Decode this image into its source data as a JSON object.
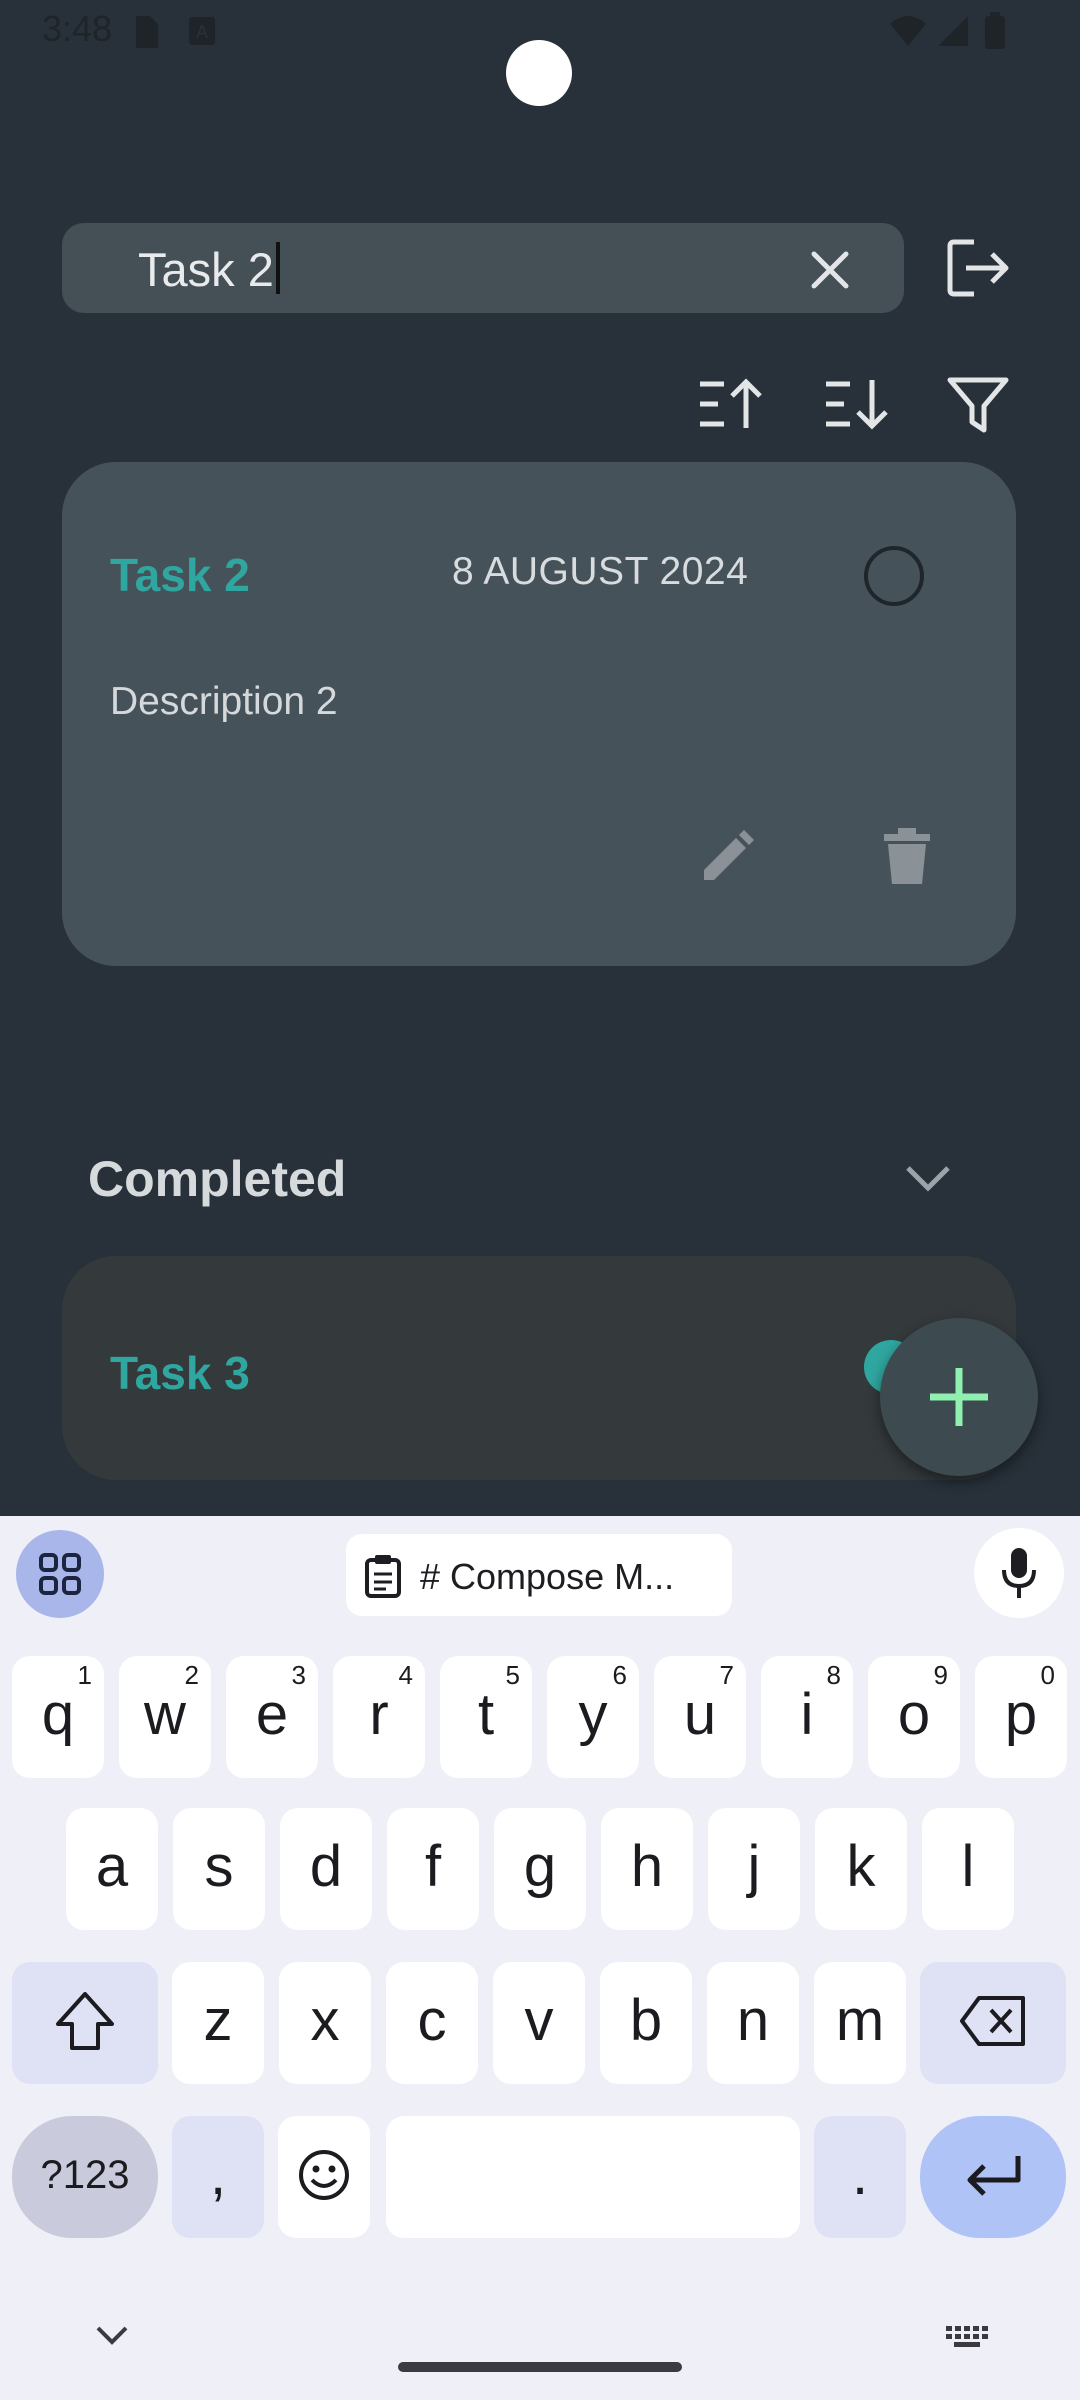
{
  "status_bar": {
    "time": "3:48"
  },
  "search": {
    "value": "Task 2"
  },
  "tasks": [
    {
      "title": "Task 2",
      "date": "8 AUGUST 2024",
      "description": "Description 2"
    }
  ],
  "completed_section": {
    "label": "Completed"
  },
  "completed_tasks": [
    {
      "title": "Task 3"
    }
  ],
  "keyboard": {
    "clipboard_suggestion": "# Compose M...",
    "row1": [
      {
        "k": "q",
        "s": "1"
      },
      {
        "k": "w",
        "s": "2"
      },
      {
        "k": "e",
        "s": "3"
      },
      {
        "k": "r",
        "s": "4"
      },
      {
        "k": "t",
        "s": "5"
      },
      {
        "k": "y",
        "s": "6"
      },
      {
        "k": "u",
        "s": "7"
      },
      {
        "k": "i",
        "s": "8"
      },
      {
        "k": "o",
        "s": "9"
      },
      {
        "k": "p",
        "s": "0"
      }
    ],
    "row2": [
      "a",
      "s",
      "d",
      "f",
      "g",
      "h",
      "j",
      "k",
      "l"
    ],
    "row3": [
      "z",
      "x",
      "c",
      "v",
      "b",
      "n",
      "m"
    ],
    "symbols_label": "?123",
    "comma": ",",
    "period": "."
  },
  "colors": {
    "accent": "#2fa7a0",
    "fab_plus": "#8ff0b0",
    "background": "#28313a"
  }
}
